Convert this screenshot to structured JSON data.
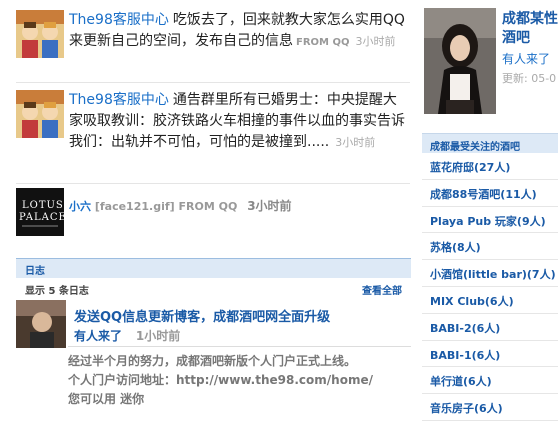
{
  "feed": [
    {
      "user": "The98客服中心",
      "text": "吃饭去了，回来就教大家怎么实用QQ来更新自己的空间，发布自己的信息",
      "from": "FROM QQ",
      "time": "3小时前"
    },
    {
      "user": "The98客服中心",
      "text": "通告群里所有已婚男士：中央提醒大家吸取教训：胶济铁路火车相撞的事件以血的事实告诉我们：出轨并不可怕，可怕的是被撞到.....",
      "time": "3小时前"
    }
  ],
  "small_item": {
    "user": "小六",
    "attachment": "[face121.gif]",
    "from": "FROM QQ",
    "time": "3小时前",
    "logo_text": "LOTUS PALACE"
  },
  "blog": {
    "section_title": "日志",
    "count_label": "显示 5 条日志",
    "view_all": "查看全部",
    "item": {
      "title": "发送QQ信息更新博客，成都酒吧网全面升级",
      "author": "有人来了",
      "time": "1小时前",
      "body_line1": "经过半个月的努力，成都酒吧新版个人门户正式上线。",
      "body_line2_prefix": "个人门户访问地址：",
      "body_link": "http://www.the98.com/home/",
      "body_line3": "您可以用 迷你"
    }
  },
  "profile": {
    "name": "成都某性仆酒吧",
    "tag": "有人来了",
    "updated": "更新: 05-0"
  },
  "sidebar": {
    "title": "成都最受关注的酒吧",
    "items": [
      "蓝花府邸(27人)",
      "成都88号酒吧(11人)",
      "Playa Pub 玩家(9人)",
      "苏格(8人)",
      "小酒馆(little bar)(7人)",
      "MIX Club(6人)",
      "BABI-2(6人)",
      "BABI-1(6人)",
      "单行道(6人)",
      "音乐房子(6人)"
    ]
  },
  "colors": {
    "link": "#1a5aa6",
    "header_bg": "#dde9f6"
  }
}
